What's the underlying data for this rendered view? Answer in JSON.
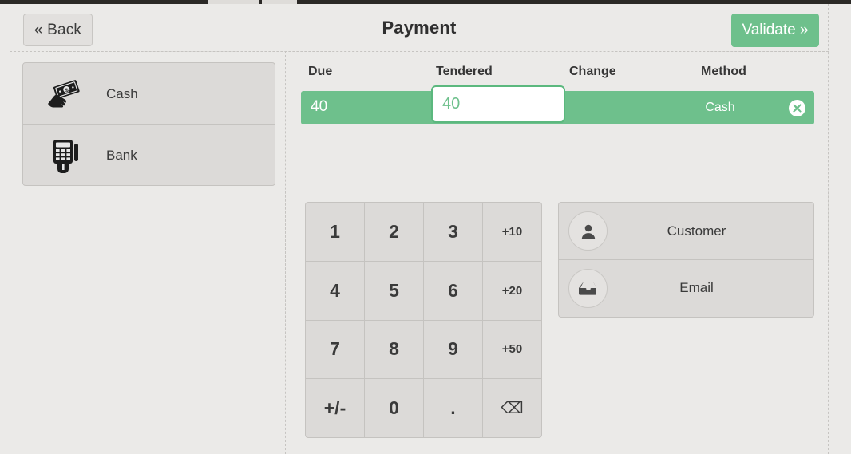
{
  "header": {
    "back_label": "« Back",
    "title": "Payment",
    "validate_label": "Validate »"
  },
  "payment_methods": [
    {
      "label": "Cash",
      "icon": "cash-banknote-icon"
    },
    {
      "label": "Bank",
      "icon": "card-terminal-icon"
    }
  ],
  "payment_table": {
    "columns": {
      "due": "Due",
      "tendered": "Tendered",
      "change": "Change",
      "method": "Method"
    },
    "row": {
      "due": "40",
      "tendered_value": "40",
      "tendered_placeholder": "",
      "change": "",
      "method": "Cash",
      "delete_icon": "times-circle-icon"
    }
  },
  "keypad": [
    {
      "label": "1",
      "kind": "digit"
    },
    {
      "label": "2",
      "kind": "digit"
    },
    {
      "label": "3",
      "kind": "digit"
    },
    {
      "label": "+10",
      "kind": "shortcut"
    },
    {
      "label": "4",
      "kind": "digit"
    },
    {
      "label": "5",
      "kind": "digit"
    },
    {
      "label": "6",
      "kind": "digit"
    },
    {
      "label": "+20",
      "kind": "shortcut"
    },
    {
      "label": "7",
      "kind": "digit"
    },
    {
      "label": "8",
      "kind": "digit"
    },
    {
      "label": "9",
      "kind": "digit"
    },
    {
      "label": "+50",
      "kind": "shortcut"
    },
    {
      "label": "+/-",
      "kind": "sign"
    },
    {
      "label": "0",
      "kind": "digit"
    },
    {
      "label": ".",
      "kind": "decimal"
    },
    {
      "label": "⌫",
      "kind": "backspace"
    }
  ],
  "actions": [
    {
      "label": "Customer",
      "icon": "user-icon"
    },
    {
      "label": "Email",
      "icon": "inbox-icon"
    }
  ],
  "colors": {
    "accent_green": "#6ec08c",
    "page_background": "#ebeae8",
    "panel_background": "#dcdad8",
    "border": "#c5c3c0"
  }
}
